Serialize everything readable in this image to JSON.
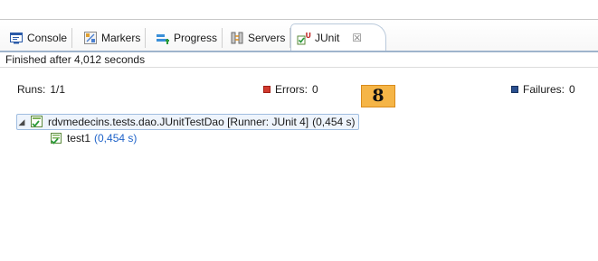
{
  "tabs": [
    {
      "label": "Console",
      "icon": "console-icon"
    },
    {
      "label": "Markers",
      "icon": "markers-icon"
    },
    {
      "label": "Progress",
      "icon": "progress-icon"
    },
    {
      "label": "Servers",
      "icon": "servers-icon"
    },
    {
      "label": "JUnit",
      "icon": "junit-icon",
      "active": true
    }
  ],
  "junit_close": "☒",
  "status": "Finished after 4,012 seconds",
  "counters": {
    "runs_label": "Runs:",
    "runs_value": "1/1",
    "errors_label": "Errors:",
    "errors_value": "0",
    "failures_label": "Failures:",
    "failures_value": "0"
  },
  "callout": "8",
  "tree": {
    "suite": {
      "name": "rdvmedecins.tests.dao.JUnitTestDao [Runner: JUnit 4]",
      "time": "(0,454 s)"
    },
    "tests": [
      {
        "name": "test1",
        "time": "(0,454 s)"
      }
    ]
  },
  "colors": {
    "error": "#d23a2e",
    "failure": "#2a4f8f",
    "callout": "#f5b547",
    "time_text": "#1f63c9"
  }
}
